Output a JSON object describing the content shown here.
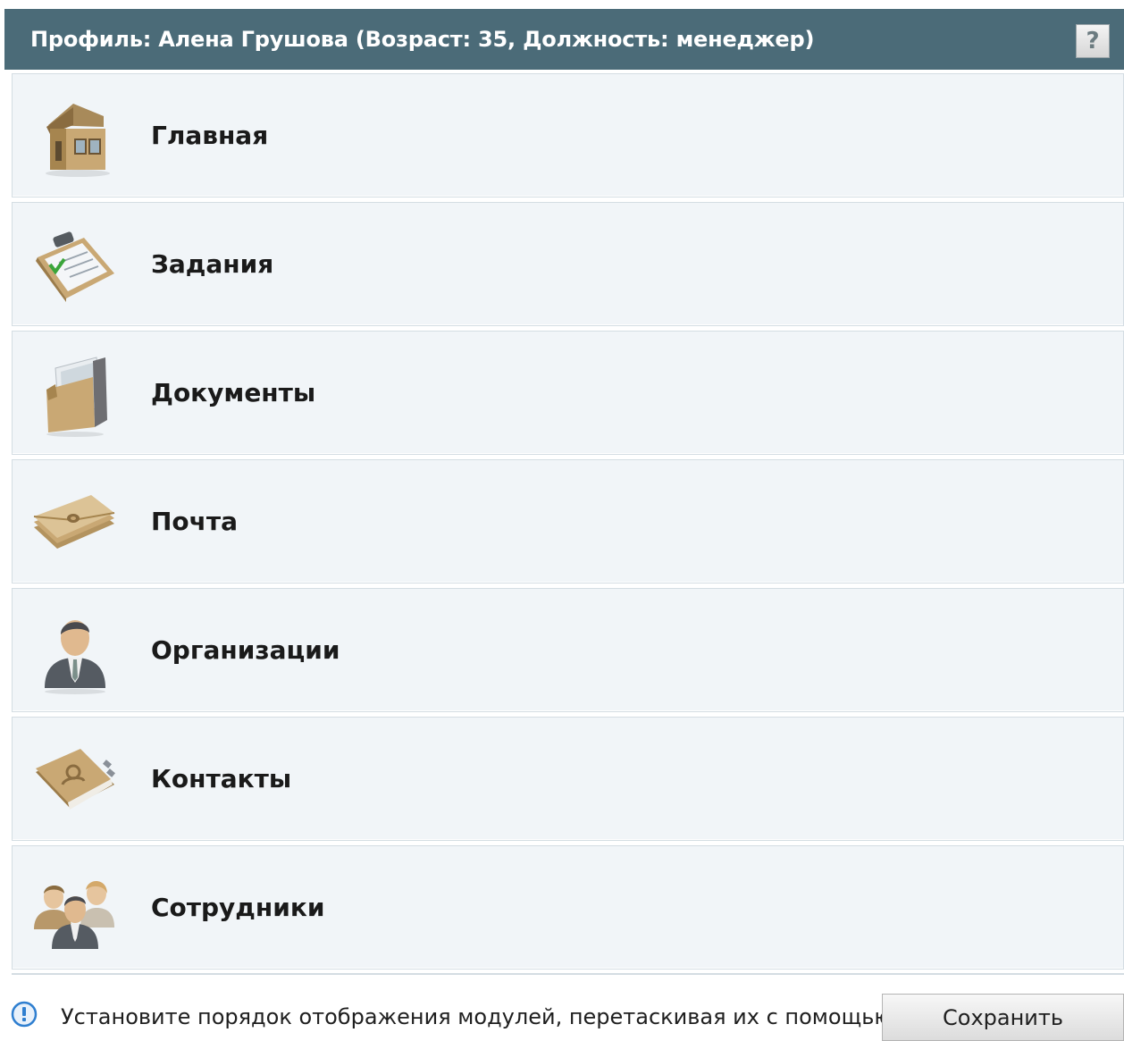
{
  "header": {
    "title": "Профиль: Алена Грушова (Возраст: 35, Должность: менеджер)",
    "help_label": "?"
  },
  "modules": [
    {
      "label": "Главная",
      "icon": "house-icon"
    },
    {
      "label": "Задания",
      "icon": "clipboard-check-icon"
    },
    {
      "label": "Документы",
      "icon": "folder-documents-icon"
    },
    {
      "label": "Почта",
      "icon": "envelope-icon"
    },
    {
      "label": "Организации",
      "icon": "businessman-icon"
    },
    {
      "label": "Контакты",
      "icon": "address-book-icon"
    },
    {
      "label": "Сотрудники",
      "icon": "people-group-icon"
    }
  ],
  "footer": {
    "hint": "Установите порядок отображения модулей, перетаскивая их с помощью мыши",
    "save_label": "Сохранить",
    "info_icon": "info-icon"
  },
  "colors": {
    "header_bg": "#4b6b78",
    "module_bg": "#f1f5f8",
    "icon_tan": "#c9a874",
    "info_blue": "#2f7fd0"
  }
}
